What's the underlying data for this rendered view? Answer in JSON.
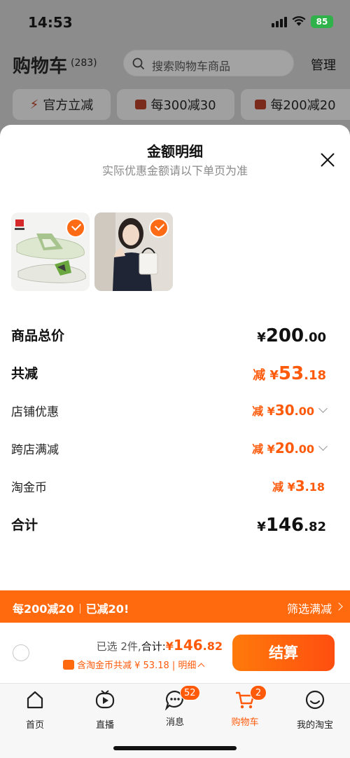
{
  "status_bar": {
    "time": "14:53",
    "battery": "85"
  },
  "background": {
    "title": "购物车",
    "count": "(283)",
    "search_placeholder": "搜索购物车商品",
    "manage": "管理",
    "chips": [
      "官方立减",
      "每300减30",
      "每200减20"
    ]
  },
  "sheet": {
    "title": "金额明细",
    "subtitle": "实际优惠金额请以下单页为准",
    "rows": {
      "total_price": {
        "label": "商品总价",
        "currency": "¥",
        "int": "200",
        "dec": ".00"
      },
      "total_discount": {
        "label": "共减",
        "prefix": "减 ¥",
        "int": "53",
        "dec": ".18"
      },
      "store_discount": {
        "label": "店铺优惠",
        "prefix": "减 ¥",
        "int": "30",
        "dec": ".00"
      },
      "cross_store": {
        "label": "跨店满减",
        "prefix": "减 ¥",
        "int": "20",
        "dec": ".00"
      },
      "taojinbi": {
        "label": "淘金币",
        "prefix": "减 ¥",
        "int": "3",
        "dec": ".18"
      },
      "sum": {
        "label": "合计",
        "currency": "¥",
        "int": "146",
        "dec": ".82"
      }
    }
  },
  "promo": {
    "left": "每200减20",
    "left2": "已减20!",
    "right": "筛选满减"
  },
  "checkout": {
    "selected": "已选 2件,",
    "total_label": "合计:",
    "currency": "¥",
    "int": "146",
    "dec": ".82",
    "sub": "含淘金币共减 ¥ 53.18 | 明细",
    "pay": "结算"
  },
  "tabs": [
    {
      "label": "首页"
    },
    {
      "label": "直播"
    },
    {
      "label": "消息",
      "badge": "52"
    },
    {
      "label": "购物车",
      "badge": "2"
    },
    {
      "label": "我的淘宝"
    }
  ],
  "colors": {
    "accent": "#ff5a0a",
    "promo_bg": "#ff6a0e",
    "pay_start": "#ff7a0a",
    "pay_end": "#ff4e10"
  }
}
